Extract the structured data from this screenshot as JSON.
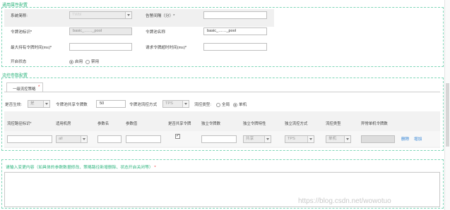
{
  "general": {
    "title": "通用属性配置",
    "system_name_label": "系统简称:",
    "system_name_value": "TWbl",
    "alarm_interval_label": "告警间隔（分）*",
    "alarm_interval_value": "",
    "token_pool_id_label": "令牌池标识*",
    "token_pool_id_value": "basic_……_pool",
    "token_pool_name_label": "令牌池名称",
    "token_pool_name_value": "basic_……_pool",
    "max_wait_label": "最大持有令牌时间(ms)*",
    "max_wait_value": "",
    "req_timeout_label": "请求令牌超时时间(ms)*",
    "req_timeout_value": "",
    "status_label": "开启状态",
    "status_enable": "启用",
    "status_disable": "禁用"
  },
  "flow": {
    "title": "流控参数配置",
    "tab_label": "一级流控策略",
    "tab_req": "*",
    "effective_label": "是否生效:",
    "effective_value": "是",
    "shared_tokens_label": "令牌池共享令牌数",
    "shared_tokens_value": "50",
    "pool_flow_mode_label": "令牌池流控方式",
    "pool_flow_mode_value": "TPS",
    "flow_type_label": "流控类型:",
    "flow_type_global": "全局",
    "flow_type_single": "单机",
    "columns": [
      "流控路径标识*",
      "适用机房",
      "参数名",
      "参数值",
      "是否共享令牌",
      "独立令牌数",
      "独立令牌特性",
      "独立流控方式",
      "流控类型",
      "异常单机令牌数"
    ],
    "row": {
      "path_id": "",
      "room": "all",
      "param_name": "",
      "param_value": "",
      "shared": "✓",
      "independent_tokens": "",
      "independent_feature": "共享",
      "independent_mode": "TPS",
      "flow_type": "单机",
      "abnormal_tokens": "",
      "delete": "删除",
      "add": "增加"
    }
  },
  "change": {
    "label": "请输入变更内容（如具体的参数数据修改、策略路径新增删除、状态开启关闭等）",
    "req": "*"
  },
  "watermark": "https://blog.csdn.net/wowotuo"
}
